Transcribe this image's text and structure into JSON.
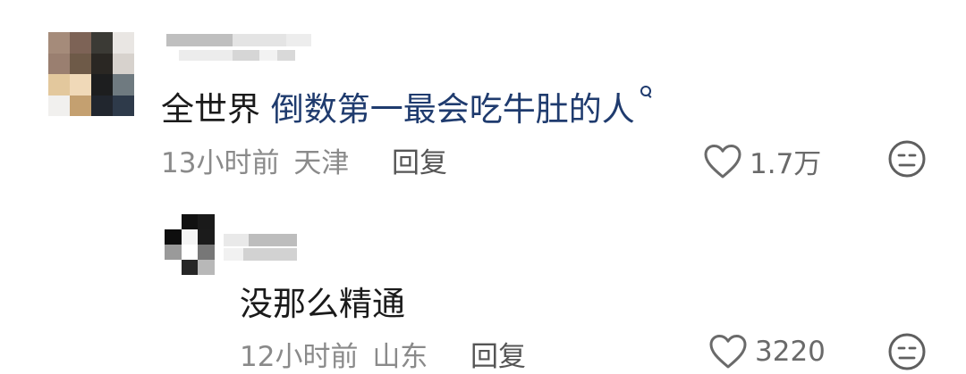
{
  "comments": [
    {
      "text_prefix": "全世界 ",
      "text_link": "倒数第一最会吃牛肚的人",
      "time": "13小时前",
      "location": "天津",
      "reply_label": "回复",
      "likes": "1.7万"
    },
    {
      "text": "没那么精通",
      "time": "12小时前",
      "location": "山东",
      "reply_label": "回复",
      "likes": "3220"
    }
  ],
  "icons": {
    "like": "heart-outline-icon",
    "dislike": "neutral-face-icon"
  },
  "colors": {
    "text": "#1a1a1a",
    "link_text": "#1f3b6e",
    "meta": "#8a8a8a",
    "icon": "#6a6a6a"
  }
}
